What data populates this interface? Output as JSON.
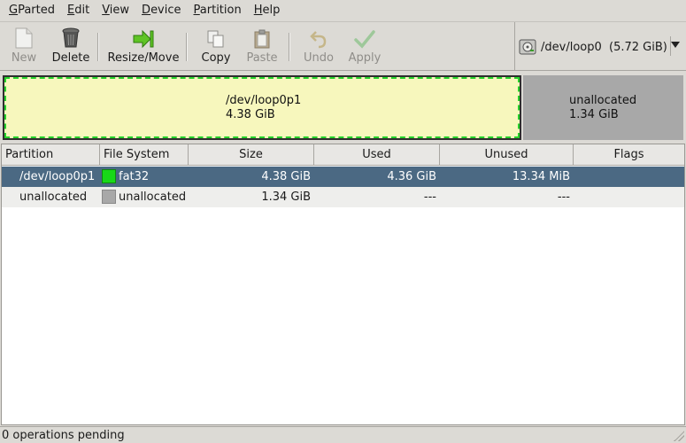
{
  "menu": [
    {
      "key": "G",
      "rest": "Parted"
    },
    {
      "key": "E",
      "rest": "dit"
    },
    {
      "key": "V",
      "rest": "iew"
    },
    {
      "key": "D",
      "rest": "evice"
    },
    {
      "key": "P",
      "rest": "artition"
    },
    {
      "key": "H",
      "rest": "elp"
    }
  ],
  "toolbar": {
    "new_label": "New",
    "delete_label": "Delete",
    "resize_label": "Resize/Move",
    "copy_label": "Copy",
    "paste_label": "Paste",
    "undo_label": "Undo",
    "apply_label": "Apply",
    "device_label": "/dev/loop0  (5.72 GiB)"
  },
  "diskmap": {
    "segments": [
      {
        "name": "/dev/loop0p1",
        "size": "4.38 GiB"
      },
      {
        "name": "unallocated",
        "size": "1.34 GiB"
      }
    ]
  },
  "table": {
    "columns": [
      "Partition",
      "File System",
      "Size",
      "Used",
      "Unused",
      "Flags"
    ],
    "rows": [
      {
        "partition": "/dev/loop0p1",
        "filesystem": "fat32",
        "size": "4.38 GiB",
        "used": "4.36 GiB",
        "unused": "13.34 MiB",
        "flags": "",
        "color": "#18d918"
      },
      {
        "partition": "unallocated",
        "filesystem": "unallocated",
        "size": "1.34 GiB",
        "used": "---",
        "unused": "---",
        "flags": "",
        "color": "#a8a8a8"
      }
    ]
  },
  "status": {
    "text": "0 operations pending"
  }
}
